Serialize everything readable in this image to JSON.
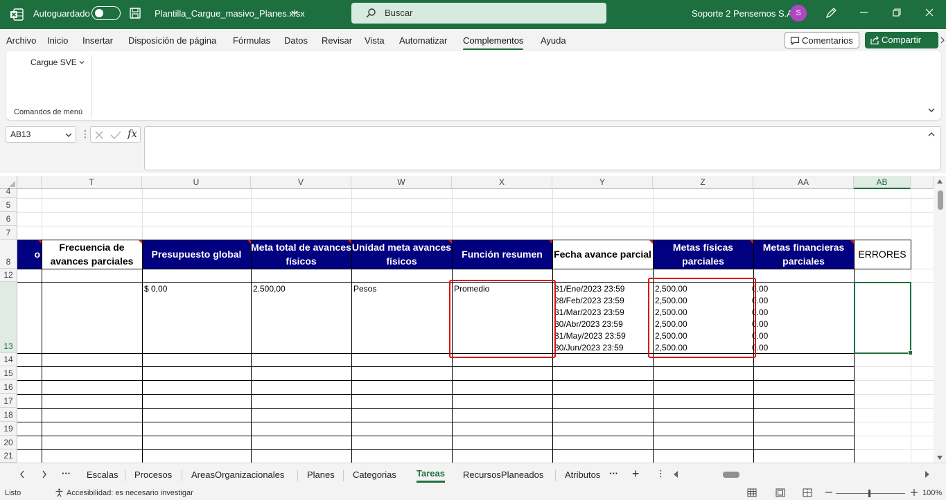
{
  "titlebar": {
    "autosave_label": "Autoguardado",
    "filename": "Plantilla_Cargue_masivo_Planes.xlsx",
    "search_placeholder": "Buscar",
    "account_name": "Soporte 2 Pensemos S.A.",
    "avatar_initial": "S"
  },
  "menu": {
    "tabs": [
      "Archivo",
      "Inicio",
      "Insertar",
      "Disposición de página",
      "Fórmulas",
      "Datos",
      "Revisar",
      "Vista",
      "Automatizar",
      "Complementos",
      "Ayuda"
    ],
    "active_tab": "Complementos",
    "comments_label": "Comentarios",
    "share_label": "Compartir"
  },
  "ribbon": {
    "button_label": "Cargue SVE",
    "group_label": "Comandos de menú"
  },
  "formula_bar": {
    "name_box": "AB13",
    "fx_label": "fx",
    "formula_value": ""
  },
  "grid": {
    "columns": [
      "T",
      "U",
      "V",
      "W",
      "X",
      "Y",
      "Z",
      "AA",
      "AB"
    ],
    "selected_column": "AB",
    "rows": [
      "4",
      "5",
      "6",
      "7",
      "8",
      "12",
      "13",
      "14",
      "15",
      "16",
      "17",
      "18",
      "19",
      "20",
      "21"
    ],
    "selected_row": "13",
    "headers": {
      "s_partial": "o",
      "t": "Frecuencia de avances parciales",
      "u": "Presupuesto global",
      "v": "Meta total de avances físicos",
      "w": "Unidad meta avances físicos",
      "x": "Función resumen",
      "y": "Fecha avance parcial",
      "z": "Metas físicas parciales",
      "aa": "Metas financieras parciales",
      "ab": "ERRORES"
    },
    "row13": {
      "u": "$ 0,00",
      "v": "2.500,00",
      "w": "Pesos",
      "x": "Promedio",
      "y": [
        "31/Ene/2023 23:59",
        "28/Feb/2023 23:59",
        "31/Mar/2023 23:59",
        "30/Abr/2023 23:59",
        "31/May/2023 23:59",
        "30/Jun/2023 23:59"
      ],
      "z": [
        "2,500.00",
        "2,500.00",
        "2,500.00",
        "2,500.00",
        "2,500.00",
        "2,500.00"
      ],
      "aa": [
        "0.00",
        "0.00",
        "0.00",
        "0.00",
        "0.00",
        "0.00"
      ]
    }
  },
  "sheets": {
    "tabs": [
      "Escalas",
      "Procesos",
      "AreasOrganizacionales",
      "Planes",
      "Categorias",
      "Tareas",
      "RecursosPlaneados",
      "Atributos"
    ],
    "active": "Tareas"
  },
  "statusbar": {
    "ready": "Listo",
    "accessibility": "Accesibilidad: es necesario investigar",
    "zoom": "100%"
  },
  "colors": {
    "excel_green": "#1e6f3f",
    "header_navy": "#000080",
    "highlight_red": "#e01010"
  }
}
